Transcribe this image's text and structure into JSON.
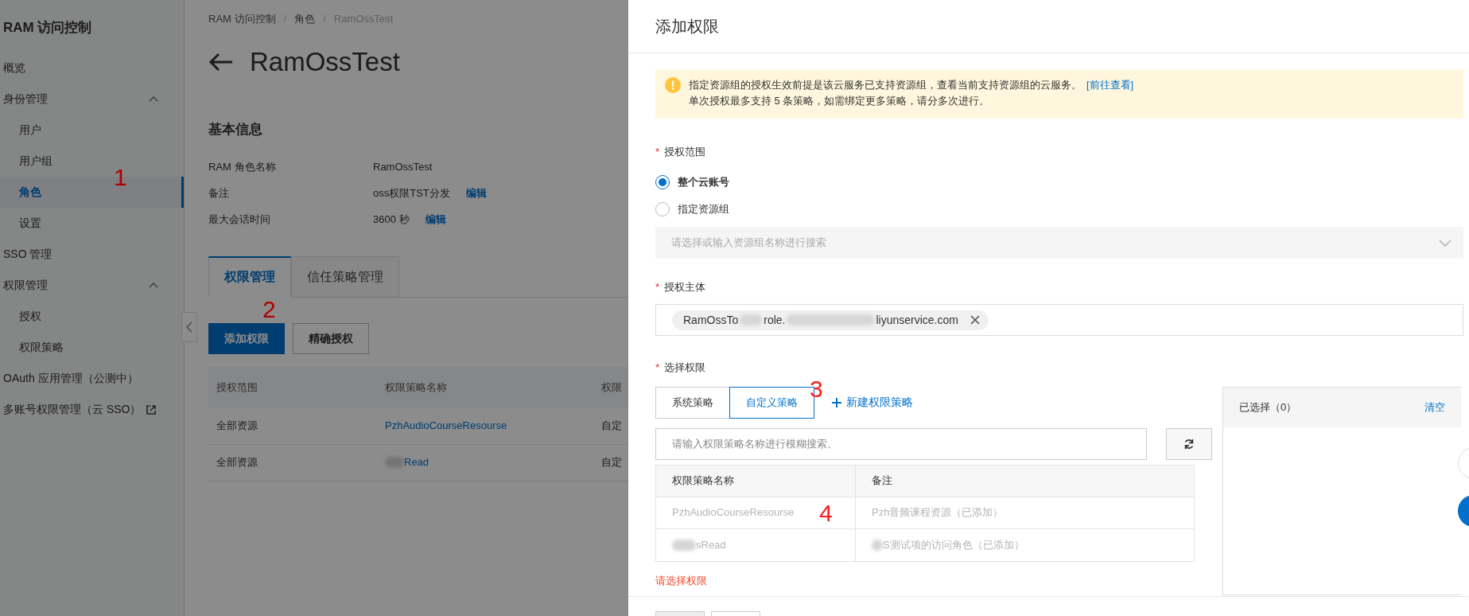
{
  "sidebar": {
    "title": "RAM 访问控制",
    "items": [
      {
        "label": "概览",
        "kind": "item",
        "selected": false
      },
      {
        "label": "身份管理",
        "kind": "group",
        "expanded": true,
        "children": [
          {
            "label": "用户",
            "selected": false
          },
          {
            "label": "用户组",
            "selected": false
          },
          {
            "label": "角色",
            "selected": true
          },
          {
            "label": "设置",
            "selected": false
          }
        ]
      },
      {
        "label": "SSO 管理",
        "kind": "item",
        "selected": false
      },
      {
        "label": "权限管理",
        "kind": "group",
        "expanded": true,
        "children": [
          {
            "label": "授权",
            "selected": false
          },
          {
            "label": "权限策略",
            "selected": false
          }
        ]
      },
      {
        "label": "OAuth 应用管理（公测中）",
        "kind": "item",
        "selected": false
      },
      {
        "label": "多账号权限管理（云 SSO）",
        "kind": "external",
        "selected": false
      }
    ]
  },
  "breadcrumb": [
    "RAM 访问控制",
    "角色",
    "RamOssTest"
  ],
  "breadcrumb_separator": "/",
  "required_mark": "*",
  "page_title": "RamOssTest",
  "basic_info": {
    "heading": "基本信息",
    "rows": [
      {
        "label": "RAM 角色名称",
        "value": "RamOssTest"
      },
      {
        "label": "备注",
        "value": "oss权限TST分发",
        "action": "编辑"
      },
      {
        "label": "最大会话时间",
        "value": "3600 秒",
        "action": "编辑"
      }
    ]
  },
  "tabs": [
    {
      "label": "权限管理",
      "selected": true
    },
    {
      "label": "信任策略管理",
      "selected": false
    }
  ],
  "buttons": [
    {
      "label": "添加权限",
      "kind": "primary"
    },
    {
      "label": "精确授权",
      "kind": "secondary"
    }
  ],
  "table": {
    "columns": [
      "授权范围",
      "权限策略名称",
      "权限"
    ],
    "rows": [
      {
        "cells": [
          "全部资源",
          "PzhAudioCourseResourse",
          "自定"
        ],
        "blurred": false
      },
      {
        "cells": [
          "全部资源",
          "Read",
          "自定"
        ],
        "blurred": true
      }
    ]
  },
  "drawer": {
    "title": "添加权限",
    "alert": {
      "line1": "指定资源组的授权生效前提是该云服务已支持资源组，查看当前支持资源组的云服务。",
      "link": "[前往查看]",
      "line2": "单次授权最多支持 5 条策略，如需绑定更多策略，请分多次进行。"
    },
    "scope": {
      "label": "授权范围",
      "options": [
        {
          "label": "整个云账号",
          "selected": true
        },
        {
          "label": "指定资源组",
          "selected": false
        }
      ],
      "select_placeholder": "请选择或输入资源组名称进行搜索"
    },
    "principal": {
      "label": "授权主体",
      "tag_parts": [
        "RamOssTo",
        "role.",
        "liyunservice.com"
      ]
    },
    "permissions": {
      "label": "选择权限",
      "tabs": [
        {
          "label": "系统策略",
          "selected": false
        },
        {
          "label": "自定义策略",
          "selected": true
        }
      ],
      "new_policy": "新建权限策略",
      "search_placeholder": "请输入权限策略名称进行模糊搜索。",
      "columns": [
        "权限策略名称",
        "备注"
      ],
      "rows": [
        {
          "name": "PzhAudioCourseResourse",
          "note": "Pzh音频课程资源（已添加）",
          "blurred": false,
          "disabled": true
        },
        {
          "name": "sRead",
          "note": "S测试项的访问角色（已添加）",
          "blurred": true,
          "disabled": true
        }
      ],
      "error": "请选择权限",
      "selected_panel": {
        "title": "已选择（0）",
        "clear": "清空"
      }
    }
  },
  "annotations": [
    "1",
    "2",
    "3",
    "4"
  ]
}
